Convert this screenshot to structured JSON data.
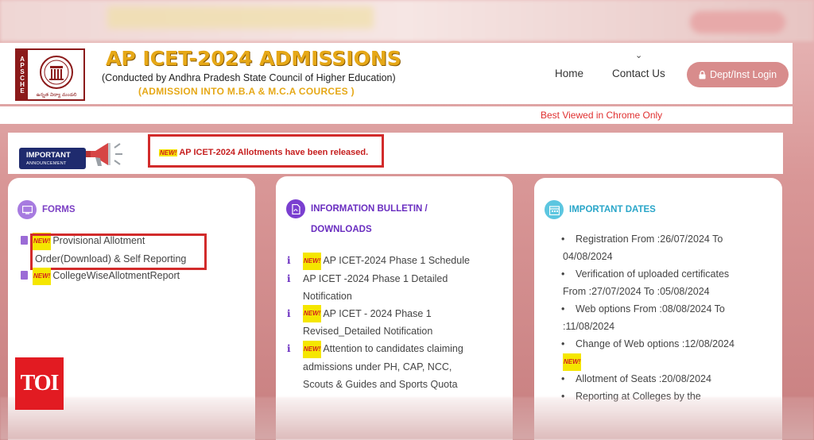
{
  "header": {
    "logo_side_text": "APSCHE",
    "logo_caption": "ఉన్నత విద్యా మండలి",
    "title": "AP ICET-2024 ADMISSIONS",
    "subtitle": "(Conducted by Andhra Pradesh State Council of Higher Education)",
    "subtitle2": "(ADMISSION INTO M.B.A & M.C.A COURCES )",
    "nav": {
      "home": "Home",
      "contact": "Contact Us",
      "chevron": "⌄"
    },
    "login_label": "Dept/Inst Login",
    "best_viewed": "Best Viewed in Chrome Only"
  },
  "announcement": {
    "badge_line1": "IMPORTANT",
    "badge_line2": "ANNOUNCEMENT",
    "new_tag": "NEW!",
    "text": "AP ICET-2024 Allotments have been released."
  },
  "forms": {
    "title": "FORMS",
    "items": [
      {
        "new": "NEW!",
        "line1": "Provisional Allotment",
        "line2": "Order(Download) & Self Reporting"
      },
      {
        "new": "NEW!",
        "line1": "CollegeWiseAllotmentReport"
      }
    ]
  },
  "info": {
    "title_line1": "INFORMATION BULLETIN /",
    "title_line2": "DOWNLOADS",
    "items": [
      {
        "new": "NEW!",
        "lines": [
          "AP ICET-2024 Phase 1 Schedule"
        ]
      },
      {
        "new": "",
        "lines": [
          "AP ICET -2024 Phase 1 Detailed",
          "Notification"
        ]
      },
      {
        "new": "NEW!",
        "lines": [
          "AP ICET - 2024 Phase 1",
          "Revised_Detailed Notification"
        ]
      },
      {
        "new": "NEW!",
        "lines": [
          "Attention to candidates claiming",
          "admissions under PH, CAP, NCC,",
          "Scouts & Guides and Sports Quota"
        ]
      }
    ]
  },
  "dates": {
    "title": "IMPORTANT DATES",
    "items": [
      {
        "line1": "Registration From :26/07/2024 To",
        "line2": "04/08/2024"
      },
      {
        "line1": "Verification of uploaded certificates",
        "line2": "From :27/07/2024 To :05/08/2024"
      },
      {
        "line1": "Web options From :08/08/2024 To",
        "line2": ":11/08/2024"
      },
      {
        "line1": "Change of Web options :12/08/2024",
        "line2": ""
      }
    ],
    "new_tag": "NEW!",
    "after_new": [
      {
        "line1": "Allotment of Seats :20/08/2024"
      },
      {
        "line1": "Reporting at Colleges by the"
      }
    ]
  },
  "watermark": "TOI",
  "colors": {
    "accent_gold": "#e6a817",
    "alert_red": "#d22b2b",
    "purple": "#6a2ec0",
    "teal": "#2aa6c9",
    "login_pink": "#d88c8c"
  }
}
